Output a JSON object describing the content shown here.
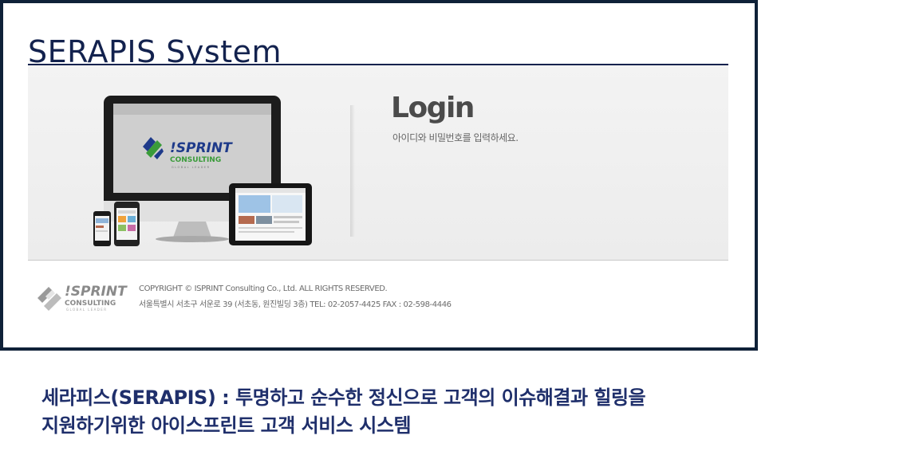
{
  "header": {
    "title": "SERAPIS System"
  },
  "login": {
    "heading": "Login",
    "subtitle": "아이디와 비밀번호를 입력하세요."
  },
  "banner": {
    "monitor_logo": {
      "brand": "!SPRINT",
      "tagline": "CONSULTING",
      "small": "GLOBAL LEADER"
    }
  },
  "footer": {
    "logo": {
      "brand": "!SPRINT",
      "tagline": "CONSULTING",
      "small": "GLOBAL LEADER"
    },
    "copyright": "COPYRIGHT © ISPRINT Consulting Co., Ltd. ALL RIGHTS RESERVED.",
    "address": "서울특별시 서초구 서운로 39 (서초동, 원진빌딩 3층) TEL: 02-2057-4425 FAX : 02-598-4446"
  },
  "caption": {
    "line1": "세라피스(SERAPIS) : 투명하고 순수한 정신으로 고객의 이슈해결과 힐링을",
    "line2": "지원하기위한 아이스프린트 고객 서비스 시스템"
  },
  "colors": {
    "frame_border": "#0f2138",
    "title": "#13224e",
    "caption": "#1f2f6b",
    "logo_blue": "#1e3a8a",
    "logo_green": "#3a9b3a"
  }
}
